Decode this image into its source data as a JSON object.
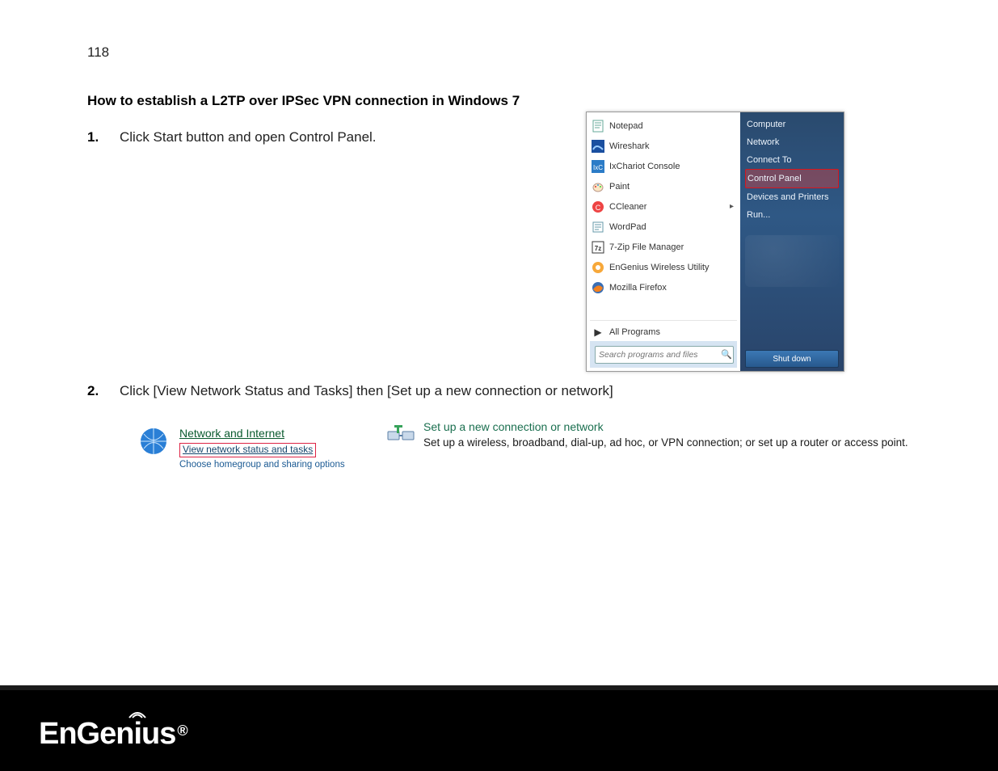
{
  "page_number": "118",
  "heading": "How to establish a L2TP over IPSec VPN connection in Windows 7",
  "steps": [
    {
      "num": "1.",
      "text": "Click Start button and open Control Panel."
    },
    {
      "num": "2.",
      "text": "Click [View Network Status and Tasks] then [Set up a new connection or network]"
    }
  ],
  "start_menu": {
    "left_items": [
      {
        "icon": "notepad-icon",
        "label": "Notepad"
      },
      {
        "icon": "wireshark-icon",
        "label": "Wireshark"
      },
      {
        "icon": "ixchariot-icon",
        "label": "IxChariot Console"
      },
      {
        "icon": "paint-icon",
        "label": "Paint"
      },
      {
        "icon": "ccleaner-icon",
        "label": "CCleaner",
        "has_submenu": true
      },
      {
        "icon": "wordpad-icon",
        "label": "WordPad"
      },
      {
        "icon": "sevenzip-icon",
        "label": "7-Zip File Manager"
      },
      {
        "icon": "engenius-util-icon",
        "label": "EnGenius Wireless Utility"
      },
      {
        "icon": "firefox-icon",
        "label": "Mozilla Firefox"
      }
    ],
    "all_programs_label": "All Programs",
    "search_placeholder": "Search programs and files",
    "right_items": [
      {
        "label": "Computer"
      },
      {
        "label": "Network"
      },
      {
        "label": "Connect To"
      },
      {
        "label": "Control Panel",
        "highlighted": true
      },
      {
        "label": "Devices and Printers"
      },
      {
        "label": "Run..."
      }
    ],
    "shutdown_label": "Shut down"
  },
  "cp_links": {
    "title": "Network and Internet",
    "highlighted_link": "View network status and tasks",
    "secondary_link": "Choose homegroup and sharing options"
  },
  "setup_block": {
    "title": "Set up a new connection or network",
    "subtitle": "Set up a wireless, broadband, dial-up, ad hoc, or VPN connection; or set up a router or access point."
  },
  "footer_brand": "EnGenius",
  "colors": {
    "accent_green": "#1a6f4f",
    "link_blue": "#1b5a93",
    "highlight_red": "#d02a2a",
    "startmenu_dark": "#2a4a6e"
  }
}
